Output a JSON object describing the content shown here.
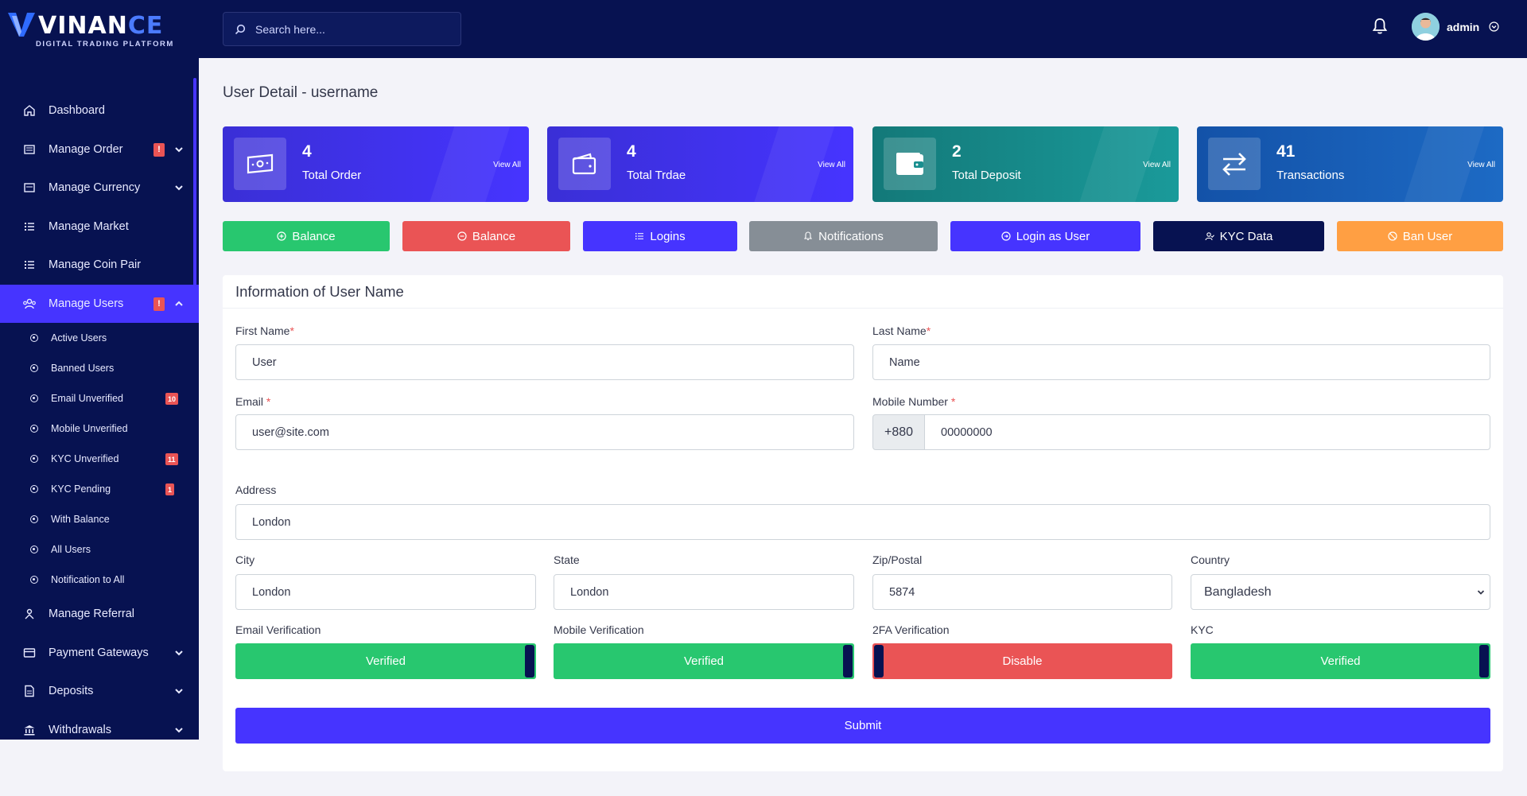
{
  "brand": {
    "name_main": "VINAN",
    "name_accent": "CE",
    "tagline": "DIGITAL TRADING PLATFORM"
  },
  "search": {
    "placeholder": "Search here..."
  },
  "user": {
    "name": "admin"
  },
  "sidebar": {
    "items": [
      {
        "label": "Dashboard"
      },
      {
        "label": "Manage Order",
        "badge": "!"
      },
      {
        "label": "Manage Currency"
      },
      {
        "label": "Manage Market"
      },
      {
        "label": "Manage Coin Pair"
      },
      {
        "label": "Manage Users",
        "badge": "!"
      }
    ],
    "sub_items": [
      {
        "label": "Active Users"
      },
      {
        "label": "Banned Users"
      },
      {
        "label": "Email Unverified",
        "badge": "10"
      },
      {
        "label": "Mobile Unverified"
      },
      {
        "label": "KYC Unverified",
        "badge": "11"
      },
      {
        "label": "KYC Pending",
        "badge": "1"
      },
      {
        "label": "With Balance"
      },
      {
        "label": "All Users"
      },
      {
        "label": "Notification to All"
      }
    ],
    "items_after": [
      {
        "label": "Manage Referral"
      },
      {
        "label": "Payment Gateways"
      },
      {
        "label": "Deposits"
      },
      {
        "label": "Withdrawals"
      }
    ]
  },
  "page": {
    "title": "User Detail - username"
  },
  "stats": [
    {
      "value": "4",
      "label": "Total Order",
      "link": "View All",
      "color": "#4634ff"
    },
    {
      "value": "4",
      "label": "Total Trdae",
      "link": "View All",
      "color": "#4634ff"
    },
    {
      "value": "2",
      "label": "Total Deposit",
      "link": "View All",
      "color": "#168a8a"
    },
    {
      "value": "41",
      "label": "Transactions",
      "link": "View All",
      "color": "#1a5fb4"
    }
  ],
  "actions": [
    {
      "label": "Balance",
      "color": "#28c76f"
    },
    {
      "label": "Balance",
      "color": "#ea5455"
    },
    {
      "label": "Logins",
      "color": "#4634ff"
    },
    {
      "label": "Notifications",
      "color": "#868e96"
    },
    {
      "label": "Login as User",
      "color": "#4634ff"
    },
    {
      "label": "KYC Data",
      "color": "#071251"
    },
    {
      "label": "Ban User",
      "color": "#ff9f43"
    }
  ],
  "form": {
    "title": "Information of User Name",
    "first_name_label": "First Name",
    "first_name_value": "User",
    "last_name_label": "Last Name",
    "last_name_value": "Name",
    "email_label": "Email",
    "email_value": "user@site.com",
    "mobile_label": "Mobile Number",
    "mobile_prefix": "+880",
    "mobile_value": "00000000",
    "address_label": "Address",
    "address_value": "London",
    "city_label": "City",
    "city_value": "London",
    "state_label": "State",
    "state_value": "London",
    "zip_label": "Zip/Postal",
    "zip_value": "5874",
    "country_label": "Country",
    "country_value": "Bangladesh",
    "required_mark": "*",
    "email_verif_label": "Email Verification",
    "email_verif_value": "Verified",
    "mobile_verif_label": "Mobile Verification",
    "mobile_verif_value": "Verified",
    "twofa_label": "2FA Verification",
    "twofa_value": "Disable",
    "kyc_label": "KYC",
    "kyc_value": "Verified",
    "submit_label": "Submit"
  },
  "colors": {
    "navy": "#071251",
    "primary": "#4634ff",
    "success": "#28c76f",
    "danger": "#ea5455"
  }
}
